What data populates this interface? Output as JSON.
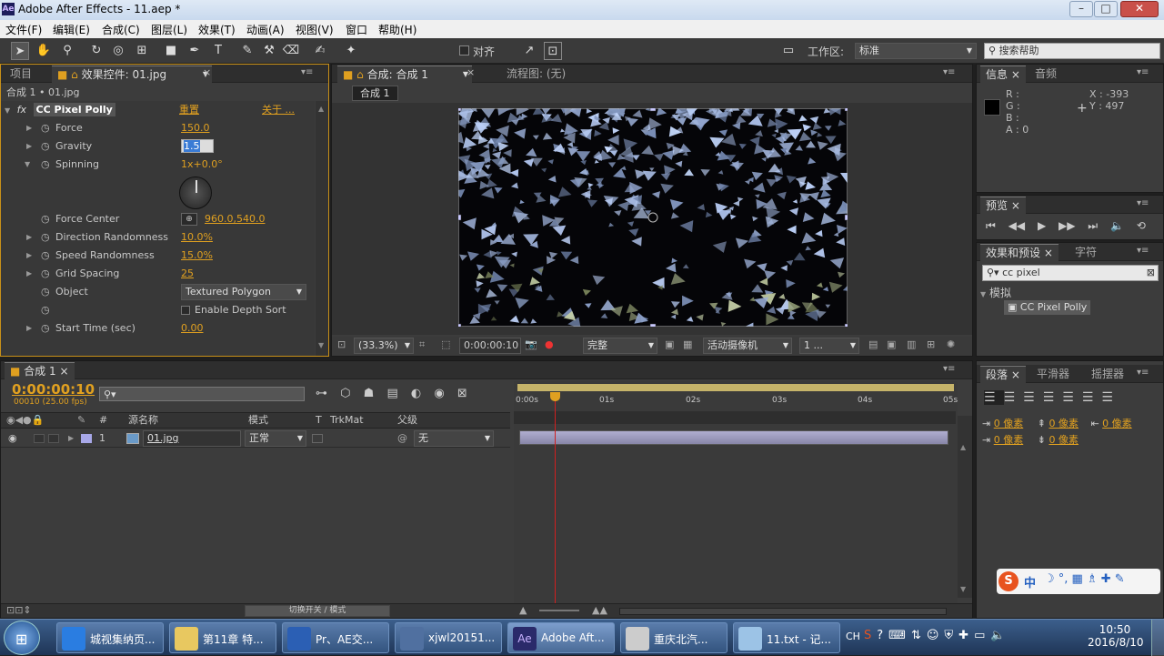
{
  "window": {
    "title": "Adobe After Effects - 11.aep *",
    "app_icon": "Ae"
  },
  "menu": [
    "文件(F)",
    "编辑(E)",
    "合成(C)",
    "图层(L)",
    "效果(T)",
    "动画(A)",
    "视图(V)",
    "窗口",
    "帮助(H)"
  ],
  "toolbar": {
    "snap_label": "对齐",
    "workspace_label": "工作区:",
    "workspace_value": "标准",
    "search_placeholder": "搜索帮助"
  },
  "left_panel": {
    "tabs": [
      "项目",
      "效果控件: 01.jpg"
    ],
    "breadcrumb": "合成 1 • 01.jpg",
    "effect_name": "CC Pixel Polly",
    "reset_label": "重置",
    "about_label": "关于 ...",
    "params": [
      {
        "name": "Force",
        "value": "150.0"
      },
      {
        "name": "Gravity",
        "value": "1.5"
      },
      {
        "name": "Spinning",
        "value": "1x+0.0°"
      },
      {
        "name": "Force Center",
        "value": "960.0,540.0"
      },
      {
        "name": "Direction Randomness",
        "value": "10.0%"
      },
      {
        "name": "Speed Randomness",
        "value": "15.0%"
      },
      {
        "name": "Grid Spacing",
        "value": "25"
      },
      {
        "name": "Object",
        "value": "Textured Polygon"
      },
      {
        "name": "",
        "value": "Enable Depth Sort"
      },
      {
        "name": "Start Time (sec)",
        "value": "0.00"
      }
    ]
  },
  "viewer": {
    "tabs": [
      "合成: 合成 1",
      "流程图: (无)"
    ],
    "comp_button": "合成 1",
    "zoom": "(33.3%)",
    "timecode": "0:00:00:10",
    "resolution": "完整",
    "camera": "活动摄像机",
    "views": "1 ..."
  },
  "info": {
    "tabs": [
      "信息",
      "音频"
    ],
    "r": "R :",
    "g": "G :",
    "b": "B :",
    "a": "A : 0",
    "x": "X : -393",
    "y": "Y : 497"
  },
  "preview": {
    "tab": "预览"
  },
  "effects_presets": {
    "tabs": [
      "效果和预设",
      "字符"
    ],
    "search_value": "cc pixel",
    "category": "模拟",
    "item": "CC Pixel Polly"
  },
  "paragraph": {
    "tabs": [
      "段落",
      "平滑器",
      "摇摆器"
    ],
    "indent_values": [
      "0 像素",
      "0 像素",
      "0 像素",
      "0 像素",
      "0 像素"
    ]
  },
  "timeline": {
    "tab": "合成 1",
    "timecode": "0:00:00:10",
    "fps": "00010 (25.00 fps)",
    "col_headers": [
      "#",
      "源名称",
      "模式",
      "T",
      "TrkMat",
      "父级"
    ],
    "layer": {
      "num": "1",
      "name": "01.jpg",
      "mode": "正常",
      "parent": "无"
    },
    "ruler": [
      "0:00s",
      "01s",
      "02s",
      "03s",
      "04s",
      "05s"
    ],
    "switch_label": "切换开关 / 模式",
    "playhead_fraction": 0.083
  },
  "ime": {
    "label": "中"
  },
  "taskbar": {
    "items": [
      {
        "label": "城视集纳页...",
        "color": "#2a7de1"
      },
      {
        "label": "第11章 特...",
        "color": "#e8c860"
      },
      {
        "label": "Pr、AE交...",
        "color": "#2b5fb4"
      },
      {
        "label": "xjwl20151...",
        "color": "#5070a0"
      },
      {
        "label": "Adobe Aft...",
        "color": "#2a2a6a"
      },
      {
        "label": "重庆北汽...",
        "color": "#ccc"
      },
      {
        "label": "11.txt - 记...",
        "color": "#9cc3e6"
      }
    ],
    "lang": "CH",
    "time": "10:50",
    "date": "2016/8/10"
  },
  "colors": {
    "accent": "#e0a020",
    "panel": "#3c3c3c",
    "playhead": "#d02020"
  }
}
